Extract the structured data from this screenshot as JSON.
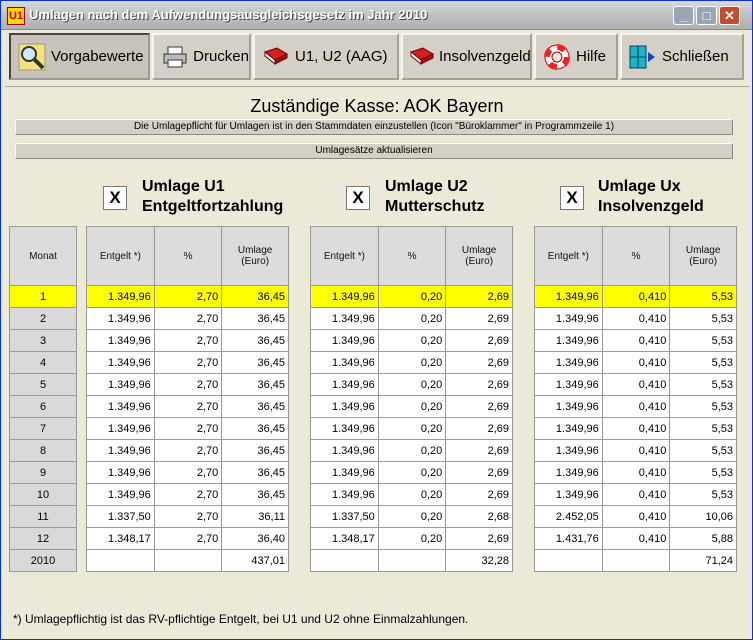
{
  "window": {
    "title": "Umlagen nach dem Aufwendungsausgleichsgesetz im Jahr 2010",
    "icon_text": "U1"
  },
  "title_buttons": {
    "minimize": "_",
    "maximize": "□",
    "close": "✕"
  },
  "toolbar": [
    {
      "label": "Vorgabewerte",
      "icon": "magnifier-icon"
    },
    {
      "label": "Drucken",
      "icon": "printer-icon"
    },
    {
      "label": "U1, U2 (AAG)",
      "icon": "book-icon"
    },
    {
      "label": "Insolvenzgeld",
      "icon": "book-icon"
    },
    {
      "label": "Hilfe",
      "icon": "lifebuoy-icon"
    },
    {
      "label": "Schließen",
      "icon": "exit-door-icon"
    }
  ],
  "kasse": "Zuständige Kasse: AOK Bayern",
  "info_bar": "Die Umlagepflicht für Umlagen ist in den Stammdaten einzustellen (Icon \"Büroklammer\" in Programmzeile 1)",
  "update_button": "Umlagesätze aktualisieren",
  "groups": [
    {
      "checkbox": "X",
      "title1": "Umlage U1",
      "title2": "Entgeltfortzahlung"
    },
    {
      "checkbox": "X",
      "title1": "Umlage U2",
      "title2": "Mutterschutz"
    },
    {
      "checkbox": "X",
      "title1": "Umlage Ux",
      "title2": "Insolvenzgeld"
    }
  ],
  "month_header": "Monat",
  "months": [
    "1",
    "2",
    "3",
    "4",
    "5",
    "6",
    "7",
    "8",
    "9",
    "10",
    "11",
    "12",
    "2010"
  ],
  "col_headers": {
    "entgelt": "Entgelt *)",
    "percent": "%",
    "umlage1": "Umlage",
    "umlage2": "(Euro)"
  },
  "tables": [
    {
      "rows": [
        [
          "1.349,96",
          "2,70",
          "36,45"
        ],
        [
          "1.349,96",
          "2,70",
          "36,45"
        ],
        [
          "1.349,96",
          "2,70",
          "36,45"
        ],
        [
          "1.349,96",
          "2,70",
          "36,45"
        ],
        [
          "1.349,96",
          "2,70",
          "36,45"
        ],
        [
          "1.349,96",
          "2,70",
          "36,45"
        ],
        [
          "1.349,96",
          "2,70",
          "36,45"
        ],
        [
          "1.349,96",
          "2,70",
          "36,45"
        ],
        [
          "1.349,96",
          "2,70",
          "36,45"
        ],
        [
          "1.349,96",
          "2,70",
          "36,45"
        ],
        [
          "1.337,50",
          "2,70",
          "36,11"
        ],
        [
          "1.348,17",
          "2,70",
          "36,40"
        ],
        [
          "",
          "",
          "437,01"
        ]
      ]
    },
    {
      "rows": [
        [
          "1.349,96",
          "0,20",
          "2,69"
        ],
        [
          "1.349,96",
          "0,20",
          "2,69"
        ],
        [
          "1.349,96",
          "0,20",
          "2,69"
        ],
        [
          "1.349,96",
          "0,20",
          "2,69"
        ],
        [
          "1.349,96",
          "0,20",
          "2,69"
        ],
        [
          "1.349,96",
          "0,20",
          "2,69"
        ],
        [
          "1.349,96",
          "0,20",
          "2,69"
        ],
        [
          "1.349,96",
          "0,20",
          "2,69"
        ],
        [
          "1.349,96",
          "0,20",
          "2,69"
        ],
        [
          "1.349,96",
          "0,20",
          "2,69"
        ],
        [
          "1.337,50",
          "0,20",
          "2,68"
        ],
        [
          "1.348,17",
          "0,20",
          "2,69"
        ],
        [
          "",
          "",
          "32,28"
        ]
      ]
    },
    {
      "rows": [
        [
          "1.349,96",
          "0,410",
          "5,53"
        ],
        [
          "1.349,96",
          "0,410",
          "5,53"
        ],
        [
          "1.349,96",
          "0,410",
          "5,53"
        ],
        [
          "1.349,96",
          "0,410",
          "5,53"
        ],
        [
          "1.349,96",
          "0,410",
          "5,53"
        ],
        [
          "1.349,96",
          "0,410",
          "5,53"
        ],
        [
          "1.349,96",
          "0,410",
          "5,53"
        ],
        [
          "1.349,96",
          "0,410",
          "5,53"
        ],
        [
          "1.349,96",
          "0,410",
          "5,53"
        ],
        [
          "1.349,96",
          "0,410",
          "5,53"
        ],
        [
          "2.452,05",
          "0,410",
          "10,06"
        ],
        [
          "1.431,76",
          "0,410",
          "5,88"
        ],
        [
          "",
          "",
          "71,24"
        ]
      ]
    }
  ],
  "selected_row": 0,
  "footnote": "*) Umlagepflichtig ist das RV-pflichtige Entgelt, bei U1 und U2 ohne Einmalzahlungen.",
  "colors": {
    "highlight": "#ffff00",
    "header_bg": "#dcdcdc",
    "window_bg": "#ece9d8"
  }
}
